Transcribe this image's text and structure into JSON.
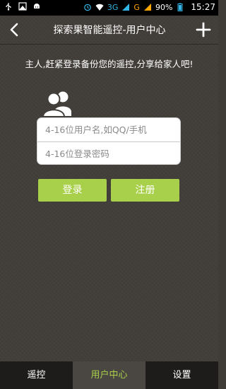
{
  "status_bar": {
    "network": "3G",
    "carrier_letter": "G",
    "battery": "90%",
    "time": "15:27"
  },
  "header": {
    "title": "探索果智能遥控-用户中心"
  },
  "tagline": "主人,赶紧登录备份您的遥控,分享给家人吧!",
  "form": {
    "username_placeholder": "4-16位用户名,如QQ/手机",
    "password_placeholder": "4-16位登录密码"
  },
  "buttons": {
    "login": "登录",
    "register": "注册"
  },
  "tabs": [
    {
      "label": "遥控"
    },
    {
      "label": "用户中心"
    },
    {
      "label": "设置"
    }
  ],
  "colors": {
    "accent": "#a8d04b",
    "background": "#423e3a",
    "tabbar": "#1e1c1b"
  }
}
